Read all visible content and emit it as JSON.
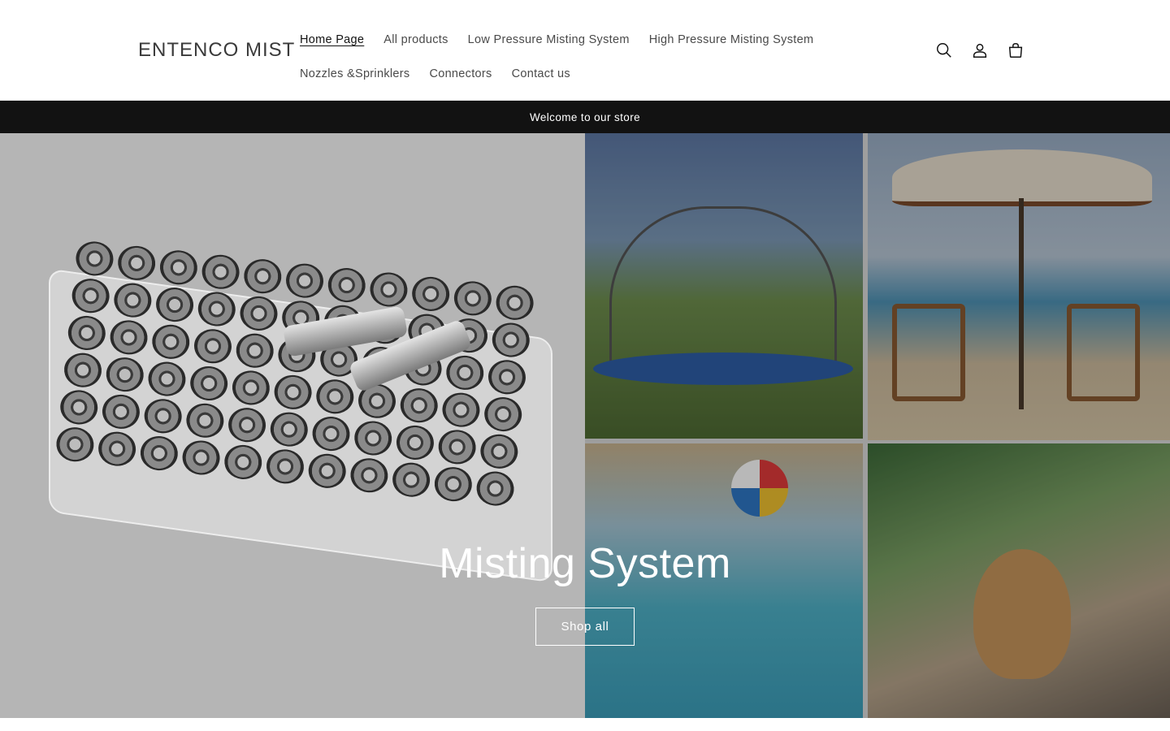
{
  "header": {
    "logo": "ENTENCO MIST",
    "nav": [
      {
        "label": "Home Page",
        "active": true
      },
      {
        "label": "All products",
        "active": false
      },
      {
        "label": "Low Pressure Misting System",
        "active": false
      },
      {
        "label": "High Pressure Misting System",
        "active": false
      },
      {
        "label": "Nozzles &Sprinklers",
        "active": false
      },
      {
        "label": "Connectors",
        "active": false
      },
      {
        "label": "Contact us",
        "active": false
      }
    ],
    "icons": [
      "search-icon",
      "account-icon",
      "cart-icon"
    ]
  },
  "announcement": {
    "text": "Welcome to our store"
  },
  "hero": {
    "title": "Misting System",
    "button_label": "Shop all"
  },
  "colors": {
    "announcement_bg": "#121212",
    "hero_text": "#ffffff",
    "text": "#121212"
  }
}
